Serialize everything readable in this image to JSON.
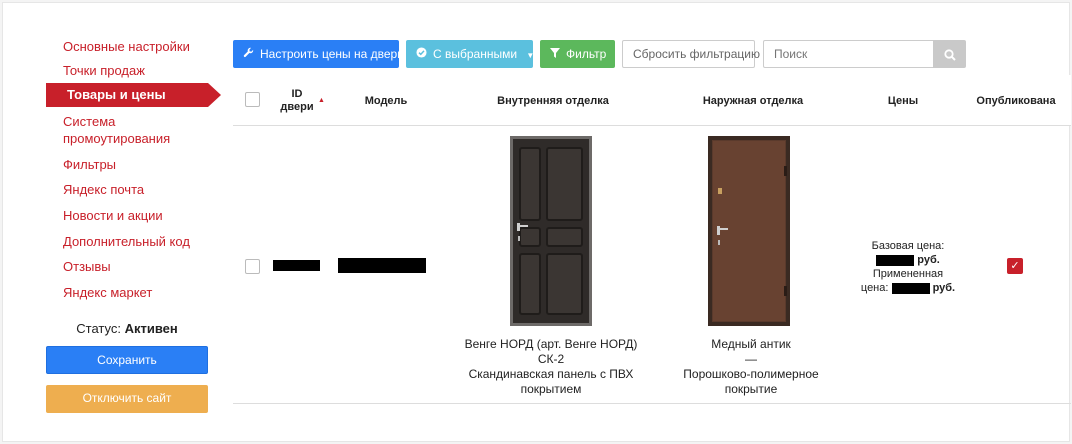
{
  "sidebar": {
    "items": [
      {
        "label": "Основные настройки"
      },
      {
        "label": "Точки продаж"
      },
      {
        "label": "Товары и цены",
        "active": true
      },
      {
        "label": "Система\nпромоутирования"
      },
      {
        "label": "Фильтры"
      },
      {
        "label": "Яндекс почта"
      },
      {
        "label": "Новости и акции"
      },
      {
        "label": "Дополнительный код"
      },
      {
        "label": "Отзывы"
      },
      {
        "label": "Яндекс маркет"
      }
    ],
    "status_label": "Статус:",
    "status_value": "Активен",
    "save_label": "Сохранить",
    "disable_label": "Отключить сайт"
  },
  "toolbar": {
    "prices_label": "Настроить цены на двери",
    "selected_label": "С выбранными",
    "filter_label": "Фильтр",
    "reset_label": "Сбросить фильтрацию",
    "search_placeholder": "Поиск"
  },
  "table": {
    "headers": {
      "id_line1": "ID",
      "id_line2": "двери",
      "model": "Модель",
      "inner": "Внутренняя отделка",
      "outer": "Наружная отделка",
      "prices": "Цены",
      "published": "Опубликована"
    },
    "rows": [
      {
        "inner_caption": "Венге НОРД (арт. Венге НОРД)\nСК-2\nСкандинавская панель с ПВХ\nпокрытием",
        "outer_caption": "Медный антик\n—\nПорошково-полимерное\nпокрытие",
        "base_price_label": "Базовая цена:",
        "currency_1": "руб.",
        "applied_price_label": "Примененная",
        "applied_price_label2": "цена:",
        "currency_2": "руб.",
        "published": true
      }
    ]
  },
  "colors": {
    "accent_red": "#c8202a",
    "primary_blue": "#2a7ff5",
    "info_cyan": "#5bc0de",
    "success_green": "#5cb85c",
    "warning_orange": "#eeae4f"
  }
}
